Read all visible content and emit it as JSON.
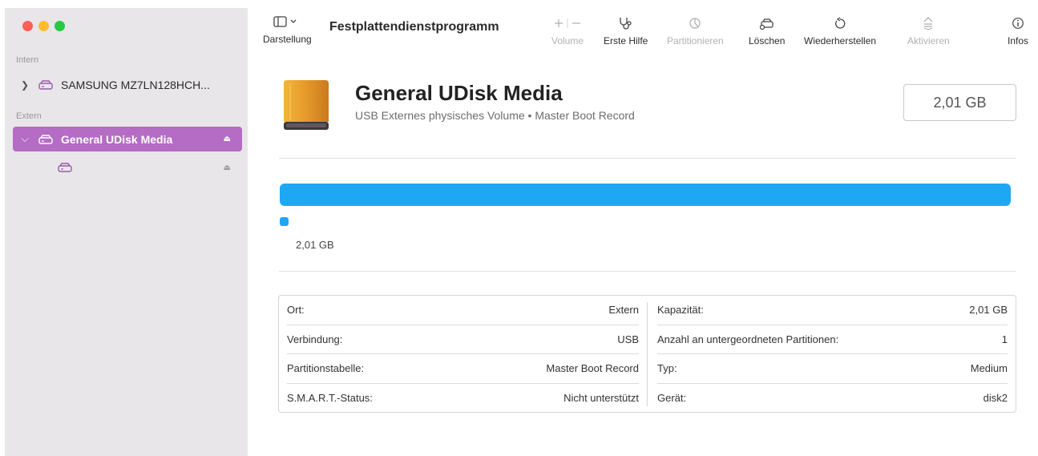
{
  "window": {
    "title": "Festplattendienstprogramm"
  },
  "toolbar": {
    "view_label": "Darstellung",
    "volume_label": "Volume",
    "firstaid_label": "Erste Hilfe",
    "partition_label": "Partitionieren",
    "erase_label": "Löschen",
    "restore_label": "Wiederherstellen",
    "mount_label": "Aktivieren",
    "info_label": "Infos"
  },
  "sidebar": {
    "internal_heading": "Intern",
    "external_heading": "Extern",
    "items": [
      {
        "label": "SAMSUNG MZ7LN128HCH...",
        "selected": false
      },
      {
        "label": "General UDisk Media",
        "selected": true
      },
      {
        "label": "",
        "selected": false
      }
    ]
  },
  "drive": {
    "name": "General UDisk Media",
    "subtitle": "USB Externes physisches Volume • Master Boot Record",
    "capacity": "2,01 GB"
  },
  "usage": {
    "fraction_used": 1.0,
    "legend_size": "2,01 GB",
    "color": "#1ea8f4"
  },
  "details": {
    "left": [
      {
        "key": "Ort:",
        "value": "Extern"
      },
      {
        "key": "Verbindung:",
        "value": "USB"
      },
      {
        "key": "Partitionstabelle:",
        "value": "Master Boot Record"
      },
      {
        "key": "S.M.A.R.T.-Status:",
        "value": "Nicht unterstützt"
      }
    ],
    "right": [
      {
        "key": "Kapazität:",
        "value": "2,01 GB"
      },
      {
        "key": "Anzahl an untergeordneten Partitionen:",
        "value": "1"
      },
      {
        "key": "Typ:",
        "value": "Medium"
      },
      {
        "key": "Gerät:",
        "value": "disk2"
      }
    ]
  },
  "colors": {
    "accent": "#b46cc4",
    "bar": "#1ea8f4",
    "drive_orange": "#e59a2a"
  }
}
